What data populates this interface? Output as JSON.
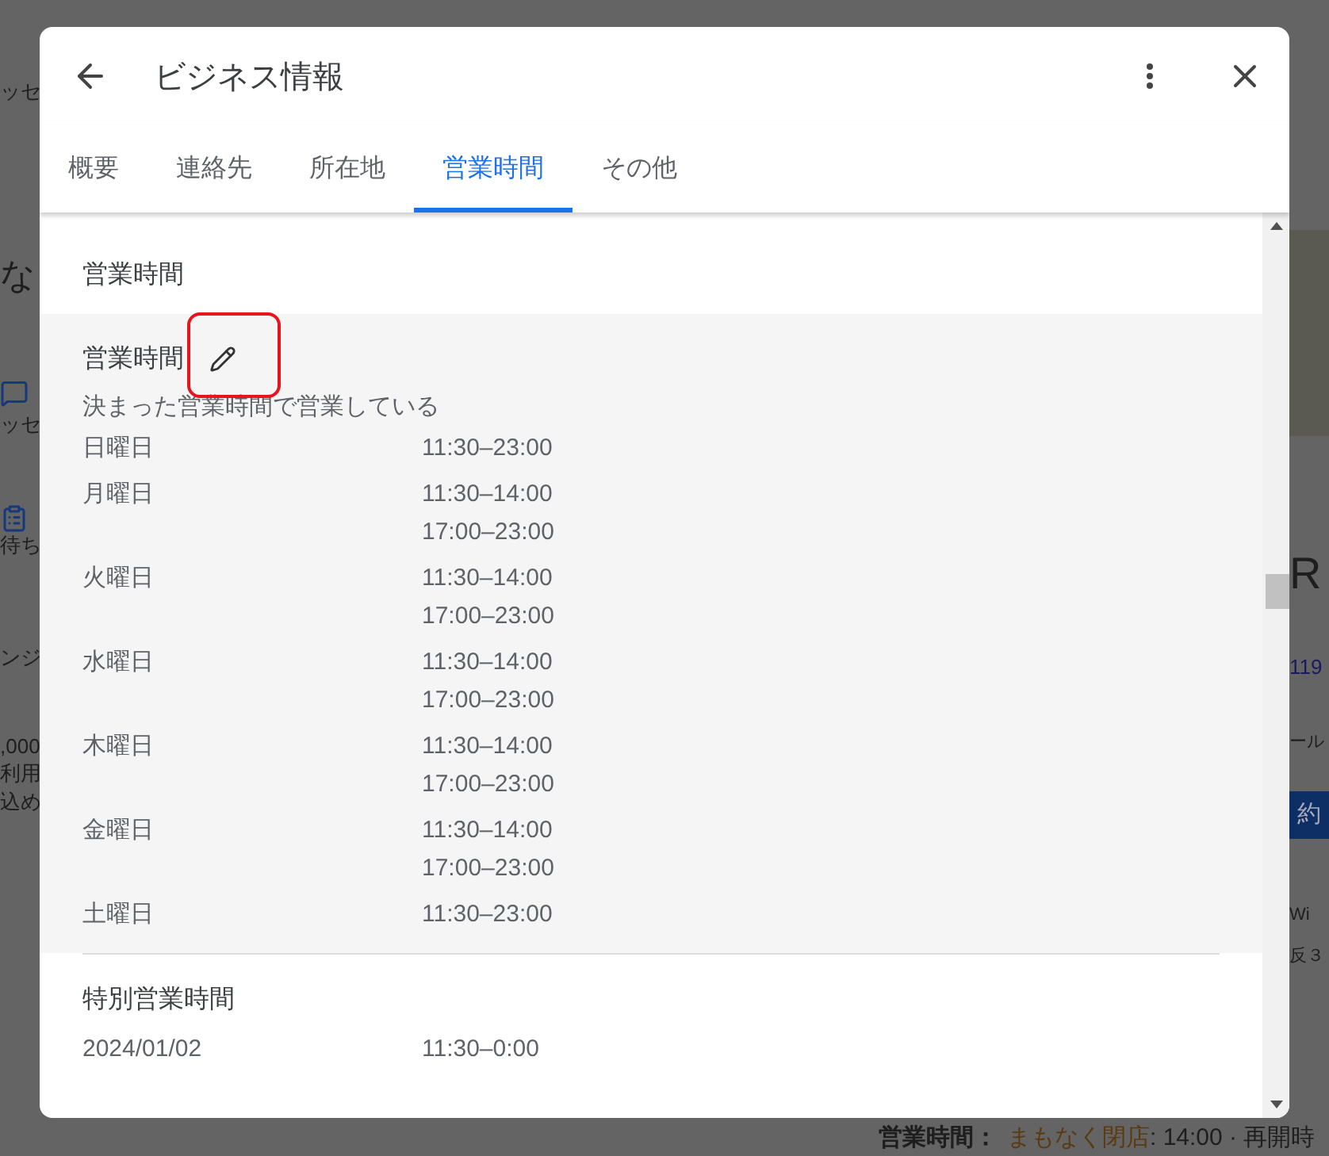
{
  "background": {
    "left_fragments": [
      {
        "text": "ッセ",
        "kind": "text"
      },
      {
        "text": "な",
        "kind": "large"
      },
      {
        "kind": "message"
      },
      {
        "text": "ッセ",
        "kind": "text"
      },
      {
        "kind": "clipboard"
      },
      {
        "text": "待ち",
        "kind": "text"
      },
      {
        "text": "ンジ",
        "kind": "text"
      },
      {
        "text": ",000",
        "kind": "text"
      },
      {
        "text": "利用",
        "kind": "text"
      },
      {
        "text": "込め",
        "kind": "text"
      }
    ],
    "right_fragments": [
      {
        "kind": "photo"
      },
      {
        "text": "R",
        "kind": "large"
      },
      {
        "text": "119",
        "kind": "link"
      },
      {
        "text": "ール",
        "kind": "text"
      },
      {
        "text": "約",
        "kind": "button"
      },
      {
        "text": "Wi",
        "kind": "text"
      },
      {
        "text": "反３",
        "kind": "text"
      }
    ],
    "status_line": {
      "label": "営業時間：",
      "status": "まもなく閉店",
      "detail": ": 14:00 · 再開時"
    }
  },
  "dialog": {
    "title": "ビジネス情報",
    "tabs": [
      {
        "label": "概要",
        "selected": false
      },
      {
        "label": "連絡先",
        "selected": false
      },
      {
        "label": "所在地",
        "selected": false
      },
      {
        "label": "営業時間",
        "selected": true
      },
      {
        "label": "その他",
        "selected": false
      }
    ],
    "section_title": "営業時間",
    "hours": {
      "title": "営業時間",
      "note": "決まった営業時間で営業している",
      "days": [
        {
          "day": "日曜日",
          "times": [
            "11:30–23:00"
          ]
        },
        {
          "day": "月曜日",
          "times": [
            "11:30–14:00",
            "17:00–23:00"
          ]
        },
        {
          "day": "火曜日",
          "times": [
            "11:30–14:00",
            "17:00–23:00"
          ]
        },
        {
          "day": "水曜日",
          "times": [
            "11:30–14:00",
            "17:00–23:00"
          ]
        },
        {
          "day": "木曜日",
          "times": [
            "11:30–14:00",
            "17:00–23:00"
          ]
        },
        {
          "day": "金曜日",
          "times": [
            "11:30–14:00",
            "17:00–23:00"
          ]
        },
        {
          "day": "土曜日",
          "times": [
            "11:30–23:00"
          ]
        }
      ]
    },
    "special_hours": {
      "title": "特別営業時間",
      "days": [
        {
          "day": "2024/01/02",
          "times": [
            "11:30–0:00"
          ]
        }
      ]
    }
  }
}
